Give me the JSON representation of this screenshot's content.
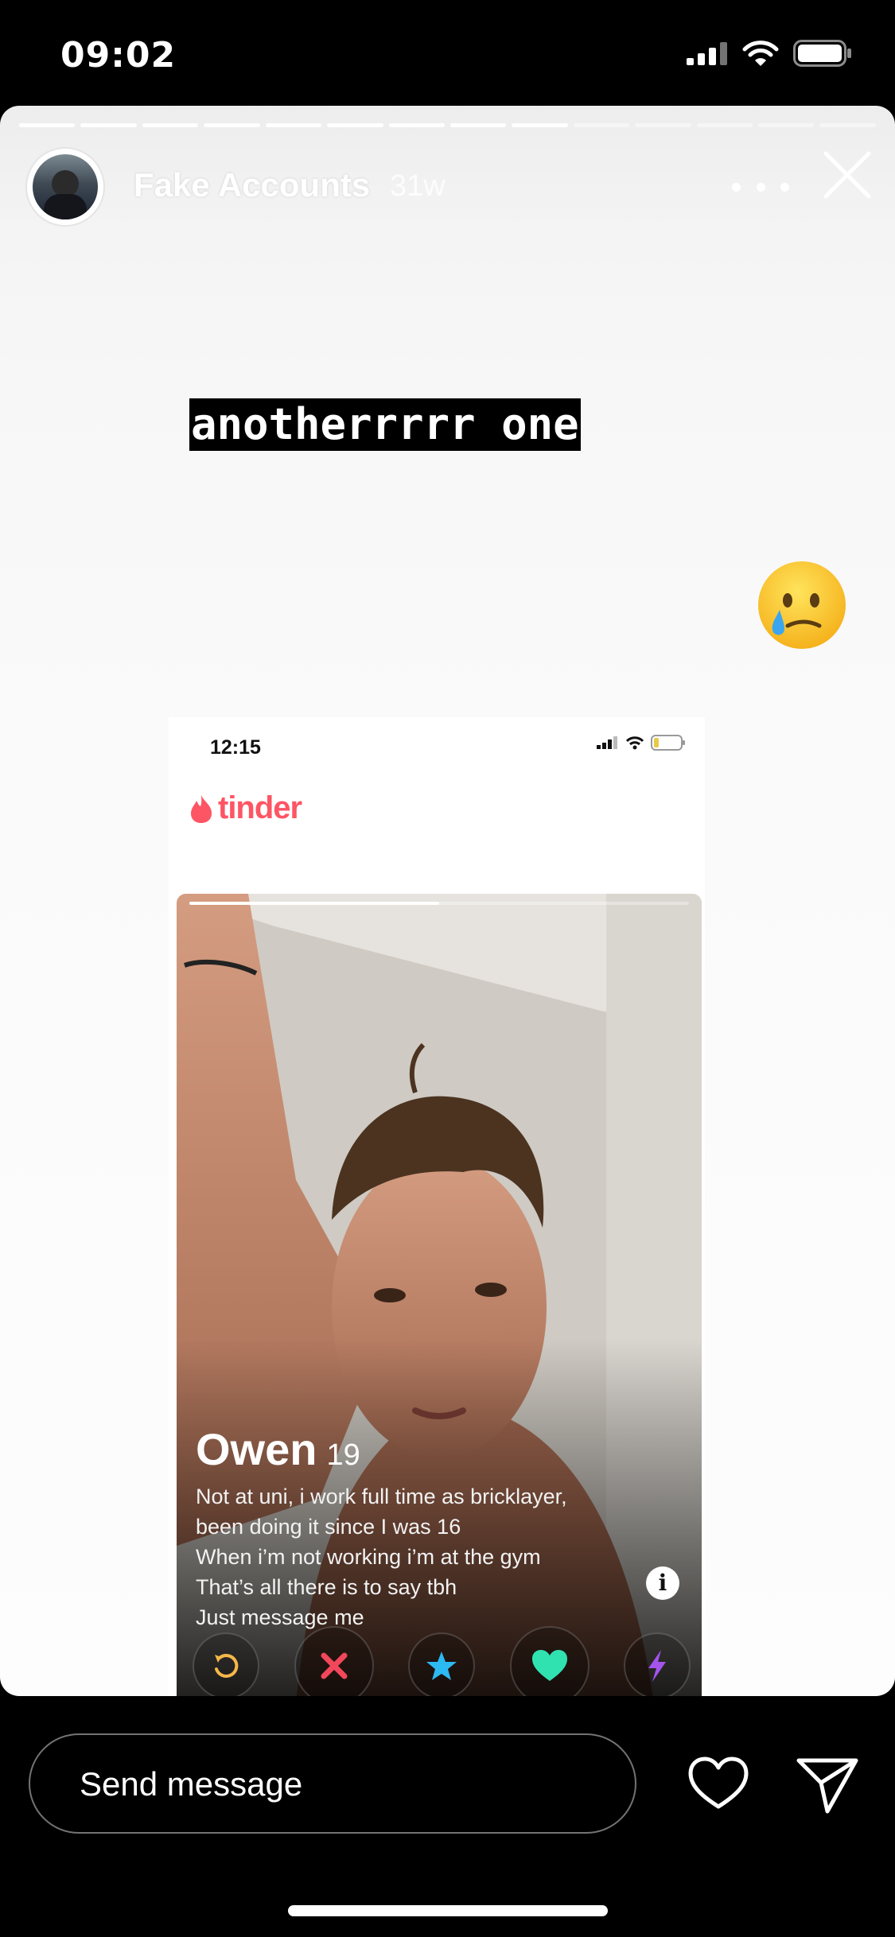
{
  "status_bar": {
    "time": "09:02"
  },
  "story": {
    "progress_total": 14,
    "progress_done": 9,
    "username": "Fake Accounts",
    "timestamp": "31w",
    "caption": "anotherrrrr one",
    "sticker": "crying-smile-emoji"
  },
  "tinder_screenshot": {
    "time": "12:15",
    "brand": "tinder",
    "photo_progress": 0.5,
    "profile": {
      "name": "Owen",
      "age": "19",
      "bio": [
        "Not at uni, i work full time as bricklayer,",
        "been doing it since I was 16",
        "When i’m not working i’m at the gym",
        "That’s all there is to say tbh",
        "Just message me"
      ]
    },
    "actions": [
      "rewind-icon",
      "nope-icon",
      "super-like-icon",
      "like-icon",
      "boost-icon"
    ],
    "colors": {
      "brand": "#fd5564",
      "rewind": "#f5b748",
      "nope": "#f2475b",
      "super_like": "#2db9f2",
      "like": "#31e2b1",
      "boost": "#a453ec"
    }
  },
  "reply_bar": {
    "placeholder": "Send message"
  }
}
